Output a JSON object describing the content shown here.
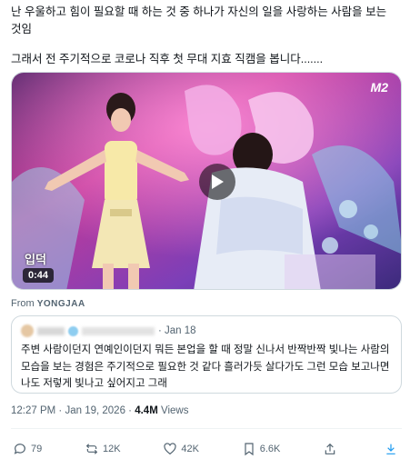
{
  "tweet": {
    "line1": "난 우울하고 힘이 필요할 때 하는 것 중 하나가 자신의 일을 사랑하는 사람을 보는",
    "line2": "것임",
    "line3": "그래서 전 주기적으로 코로나 직후 첫 무대 지효 직캠을 봅니다......."
  },
  "media": {
    "duration": "0:44",
    "logo": "M2",
    "corner_tag": "입덕",
    "from_label": "From",
    "from_account": "YONGJAA"
  },
  "quote": {
    "date": "· Jan 18",
    "text": "주변 사람이던지 연예인이던지 뭐든 본업을 할 때 정말 신나서 반짝반짝 빛나는 사람의 모습을 보는 경험은 주기적으로 필요한 것 같다 흘러가듯 살다가도 그런 모습 보고나면 나도 저렇게 빛나고 싶어지고 그래"
  },
  "meta": {
    "time": "12:27 PM",
    "sep1": " · ",
    "date": "Jan 19, 2026",
    "sep2": " · ",
    "views_count": "4.4M",
    "views_label": " Views"
  },
  "actions": {
    "replies": "79",
    "reposts": "12K",
    "likes": "42K",
    "bookmarks": "6.6K"
  },
  "colors": {
    "icon_gray": "#536471",
    "share_blue": "#1d9bf0",
    "border": "#cfd9de"
  }
}
